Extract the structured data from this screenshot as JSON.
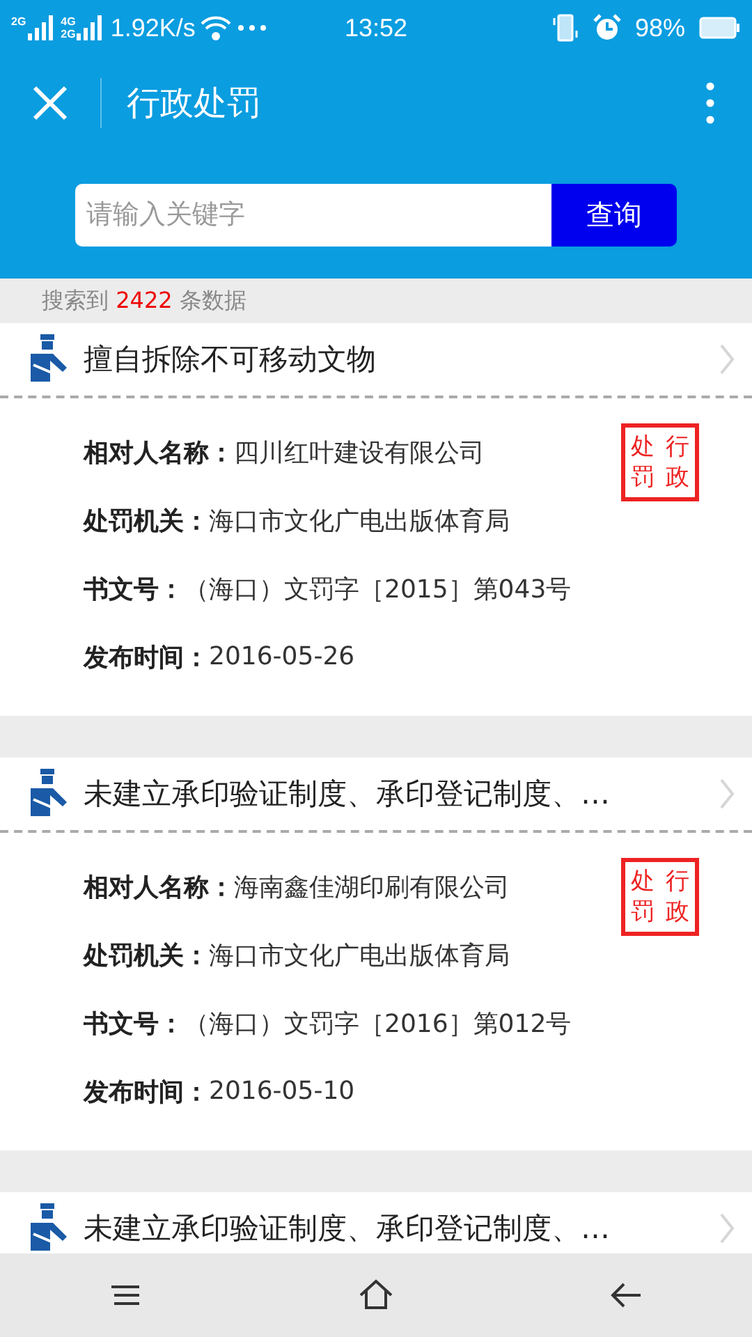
{
  "status_bar": {
    "sim1_label": "2G",
    "sim2_labels": [
      "4G",
      "2G"
    ],
    "speed": "1.92K/s",
    "time": "13:52",
    "battery": "98%"
  },
  "header": {
    "title": "行政处罚"
  },
  "search": {
    "placeholder": "请输入关键字",
    "button": "查询"
  },
  "result_count": {
    "prefix": "搜索到",
    "count": "2422",
    "suffix": "条数据"
  },
  "records": [
    {
      "title": "擅自拆除不可移动文物",
      "stamp": [
        "处",
        "行",
        "罚",
        "政"
      ],
      "fields": [
        {
          "label": "相对人名称：",
          "value": "四川红叶建设有限公司"
        },
        {
          "label": "处罚机关：",
          "value": "海口市文化广电出版体育局"
        },
        {
          "label": "书文号：",
          "value": "（海口）文罚字［2015］第043号"
        },
        {
          "label": "发布时间：",
          "value": "2016-05-26"
        }
      ]
    },
    {
      "title": "未建立承印验证制度、承印登记制度、…",
      "stamp": [
        "处",
        "行",
        "罚",
        "政"
      ],
      "fields": [
        {
          "label": "相对人名称：",
          "value": "海南鑫佳湖印刷有限公司"
        },
        {
          "label": "处罚机关：",
          "value": "海口市文化广电出版体育局"
        },
        {
          "label": "书文号：",
          "value": "（海口）文罚字［2016］第012号"
        },
        {
          "label": "发布时间：",
          "value": "2016-05-10"
        }
      ]
    },
    {
      "title": "未建立承印验证制度、承印登记制度、…"
    }
  ]
}
